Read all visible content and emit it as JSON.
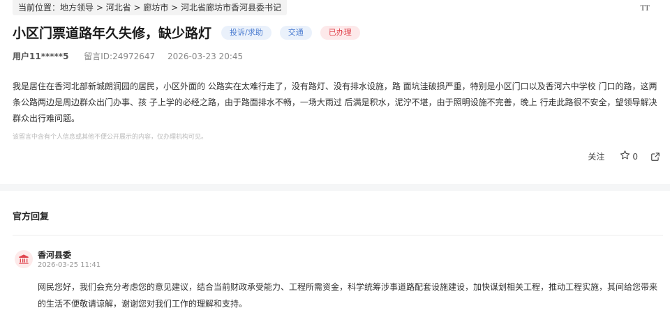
{
  "breadcrumb": {
    "text": "当前位置：地方领导 > 河北省 > 廊坊市 > 河北省廊坊市香河县委书记"
  },
  "font_size_toggle": {
    "label": "TT"
  },
  "message": {
    "title": "小区门票道路年久失修，缺少路灯",
    "tags": [
      {
        "label": "投诉/求助",
        "color": "#4a7bd0"
      },
      {
        "label": "交通",
        "color": "#4a7bd0"
      },
      {
        "label": "已办理",
        "color": "#e0464f"
      }
    ],
    "user": "用户11*****5",
    "id_text": "留言ID:24972647",
    "datetime": "2026-03-23 20:45",
    "content": "我是居住在香河北部新城朗润园的居民，小区外面的 公路实在太难行走了，没有路灯、没有排水设施，路 面坑洼破损严重，特别是小区门口以及香河六中学校 门口的路，这两条公路两边是周边群众出门办事、孩 子上学的必经之路，由于路面排水不畅，一场大雨过 后满是积水，泥泞不堪，由于照明设施不完善，晚上 行走此路很不安全，望领导解决群众出行难问题。",
    "privacy_note": "该留言中含有个人信息或其他不便公开展示的内容，仅办理机构可见。"
  },
  "actions": {
    "follow_label": "关注",
    "star_count": "0",
    "star_icon": "star-icon",
    "share_icon": "share-icon"
  },
  "reply_section": {
    "title": "官方回复",
    "author": "香河县委",
    "date": "2026-03-25 11:41",
    "avatar_icon": "government-building-icon",
    "text": "网民您好，我们会充分考虑您的意见建议，结合当前财政承受能力、工程所需资金，科学统筹涉事道路配套设施建设，加快谋划相关工程，推动工程实施，其间给您带来的生活不便敬请谅解，谢谢您对我们工作的理解和支持。"
  }
}
